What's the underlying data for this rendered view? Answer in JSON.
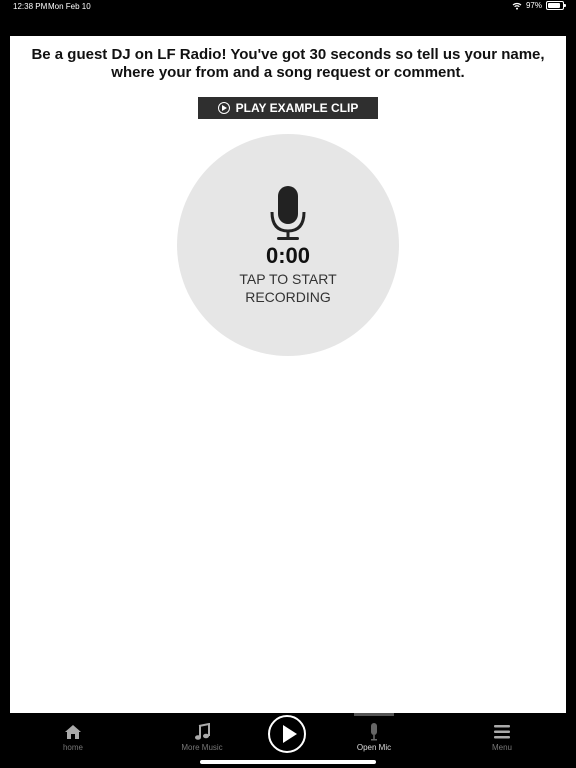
{
  "status": {
    "time": "12:38 PM",
    "date": "Mon Feb 10",
    "battery": "97%",
    "battery_level": 0.97
  },
  "prompt": "Be a guest DJ on LF Radio! You've got 30 seconds so tell us your name, where your from and a song request or comment.",
  "play_clip_label": "PLAY EXAMPLE CLIP",
  "recorder": {
    "timer": "0:00",
    "label": "TAP TO START RECORDING"
  },
  "tabs": [
    {
      "label": "home",
      "icon": "home-icon"
    },
    {
      "label": "More Music",
      "icon": "music-note-icon"
    },
    {
      "label": "Open Mic",
      "icon": "microphone-icon",
      "active": true
    },
    {
      "label": "Menu",
      "icon": "menu-icon"
    }
  ],
  "center_button_icon": "play-circle-icon"
}
